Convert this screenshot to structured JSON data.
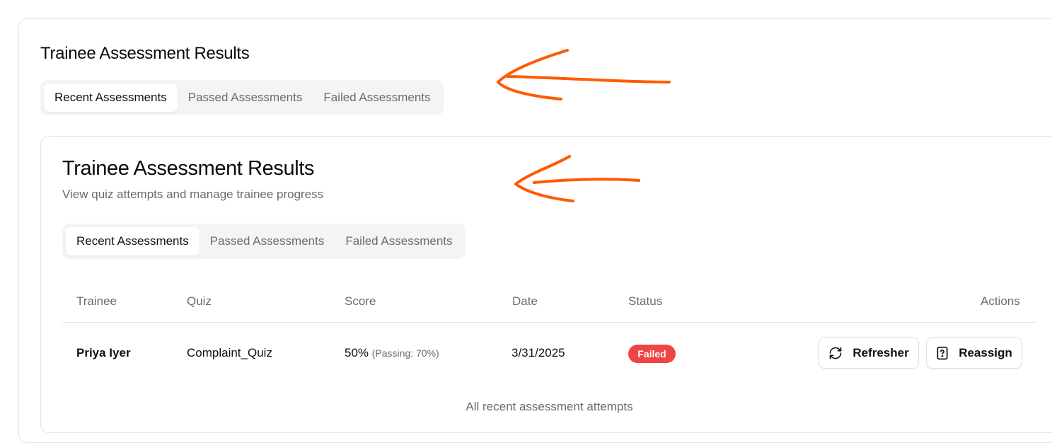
{
  "page": {
    "title": "Trainee Assessment Results"
  },
  "outer_tabs": [
    {
      "label": "Recent Assessments",
      "active": true
    },
    {
      "label": "Passed Assessments",
      "active": false
    },
    {
      "label": "Failed Assessments",
      "active": false
    }
  ],
  "card": {
    "title": "Trainee Assessment Results",
    "subtitle": "View quiz attempts and manage trainee progress",
    "tabs": [
      {
        "label": "Recent Assessments",
        "active": true
      },
      {
        "label": "Passed Assessments",
        "active": false
      },
      {
        "label": "Failed Assessments",
        "active": false
      }
    ]
  },
  "table": {
    "headers": {
      "trainee": "Trainee",
      "quiz": "Quiz",
      "score": "Score",
      "date": "Date",
      "status": "Status",
      "actions": "Actions"
    },
    "rows": [
      {
        "trainee": "Priya Iyer",
        "quiz": "Complaint_Quiz",
        "score": "50%",
        "passing": "(Passing: 70%)",
        "date": "3/31/2025",
        "status": "Failed",
        "actions": [
          {
            "label": "Refresher",
            "icon": "refresh-icon"
          },
          {
            "label": "Reassign",
            "icon": "file-question-icon"
          }
        ]
      }
    ],
    "caption": "All recent assessment attempts"
  },
  "colors": {
    "status_failed": "#ef4444",
    "annotation_arrow": "#ff5a00",
    "muted_text": "#6b6b6b",
    "tab_track": "#f4f4f4"
  }
}
